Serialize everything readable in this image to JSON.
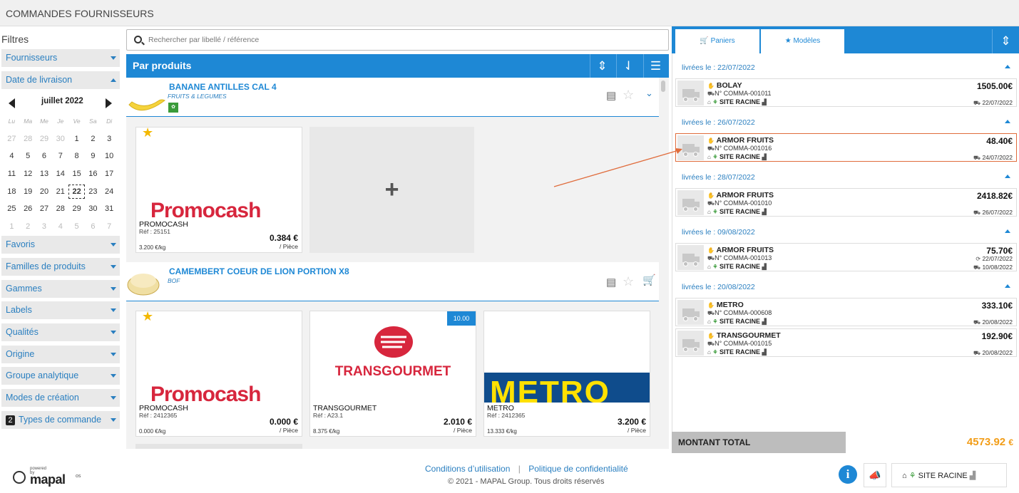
{
  "header": {
    "title": "COMMANDES FOURNISSEURS"
  },
  "filters": {
    "title": "Filtres",
    "items": [
      {
        "label": "Fournisseurs"
      },
      {
        "label": "Date de livraison"
      },
      {
        "label": "Favoris"
      },
      {
        "label": "Familles de produits"
      },
      {
        "label": "Gammes"
      },
      {
        "label": "Labels"
      },
      {
        "label": "Qualités"
      },
      {
        "label": "Origine"
      },
      {
        "label": "Groupe analytique"
      },
      {
        "label": "Modes de création"
      },
      {
        "label": "Types de commande",
        "badge": "2"
      }
    ]
  },
  "calendar": {
    "month": "juillet 2022",
    "weekdays": [
      "Lu",
      "Ma",
      "Me",
      "Je",
      "Ve",
      "Sa",
      "Di"
    ],
    "weeks": [
      [
        "27",
        "28",
        "29",
        "30",
        "1",
        "2",
        "3"
      ],
      [
        "4",
        "5",
        "6",
        "7",
        "8",
        "9",
        "10"
      ],
      [
        "11",
        "12",
        "13",
        "14",
        "15",
        "16",
        "17"
      ],
      [
        "18",
        "19",
        "20",
        "21",
        "22",
        "23",
        "24"
      ],
      [
        "25",
        "26",
        "27",
        "28",
        "29",
        "30",
        "31"
      ],
      [
        "1",
        "2",
        "3",
        "4",
        "5",
        "6",
        "7"
      ]
    ],
    "today": "22"
  },
  "search": {
    "placeholder": "Rechercher par libellé / référence"
  },
  "products_bar": {
    "title": "Par produits"
  },
  "products": [
    {
      "name": "BANANE ANTILLES CAL 4",
      "category": "FRUITS & LEGUMES",
      "offers": [
        {
          "supplier": "PROMOCASH",
          "logo": "Promocash",
          "ref": "Réf : 25151",
          "price": "0.384 €",
          "unit": "/ Pièce",
          "per_kg": "3.200 €/kg"
        }
      ]
    },
    {
      "name": "CAMEMBERT COEUR DE LION PORTION X8",
      "category": "BOF",
      "offers": [
        {
          "supplier": "PROMOCASH",
          "logo": "Promocash",
          "ref": "Réf : 2412365",
          "price": "0.000 €",
          "unit": "/ Pièce",
          "per_kg": "0.000 €/kg"
        },
        {
          "supplier": "TRANSGOURMET",
          "logo": "TRANSGOURMET",
          "ref": "Réf : A23.1",
          "price": "2.010 €",
          "unit": "/ Pièce",
          "per_kg": "8.375 €/kg",
          "tag": "10.00"
        },
        {
          "supplier": "METRO",
          "logo": "METRO",
          "ref": "Réf : 2412365",
          "price": "3.200 €",
          "unit": "/ Pièce",
          "per_kg": "13.333 €/kg"
        }
      ]
    }
  ],
  "right_panel": {
    "tabs": [
      {
        "label": "Paniers"
      },
      {
        "label": "Modèles"
      }
    ],
    "groups": [
      {
        "date_label": "livrées le : 22/07/2022",
        "orders": [
          {
            "supplier": "BOLAY",
            "number": "N° COMMA-001011",
            "site": "SITE RACINE",
            "amount": "1505.00€",
            "date": "22/07/2022"
          }
        ]
      },
      {
        "date_label": "livrées le : 26/07/2022",
        "orders": [
          {
            "supplier": "ARMOR FRUITS",
            "number": "N° COMMA-001016",
            "site": "SITE RACINE",
            "amount": "48.40€",
            "date": "24/07/2022",
            "selected": true
          }
        ]
      },
      {
        "date_label": "livrées le : 28/07/2022",
        "orders": [
          {
            "supplier": "ARMOR FRUITS",
            "number": "N° COMMA-001010",
            "site": "SITE RACINE",
            "amount": "2418.82€",
            "date": "26/07/2022"
          }
        ]
      },
      {
        "date_label": "livrées le : 09/08/2022",
        "orders": [
          {
            "supplier": "ARMOR FRUITS",
            "number": "N° COMMA-001013",
            "site": "SITE RACINE",
            "amount": "75.70€",
            "date2": "22/07/2022",
            "date": "10/08/2022"
          }
        ]
      },
      {
        "date_label": "livrées le : 20/08/2022",
        "orders": [
          {
            "supplier": "METRO",
            "number": "N° COMMA-000608",
            "site": "SITE RACINE",
            "amount": "333.10€",
            "date": "20/08/2022"
          },
          {
            "supplier": "TRANSGOURMET",
            "number": "N° COMMA-001015",
            "site": "SITE RACINE",
            "amount": "192.90€",
            "date": "20/08/2022"
          }
        ]
      }
    ],
    "total_label": "MONTANT TOTAL",
    "total_value": "4573.92",
    "total_currency": "€"
  },
  "footer": {
    "terms": "Conditions d’utilisation",
    "separator": "|",
    "privacy": "Politique de confidentialité",
    "copyright": "© 2021 - MAPAL Group. Tous droits réservés",
    "logo_powered": "powered by",
    "logo_name": "mapal",
    "logo_os": "os",
    "site_button": "SITE RACINE",
    "info_label": "i"
  },
  "colors": {
    "accent": "#1e88d5",
    "total": "#f29d18",
    "selected_border": "#e06c3c"
  }
}
